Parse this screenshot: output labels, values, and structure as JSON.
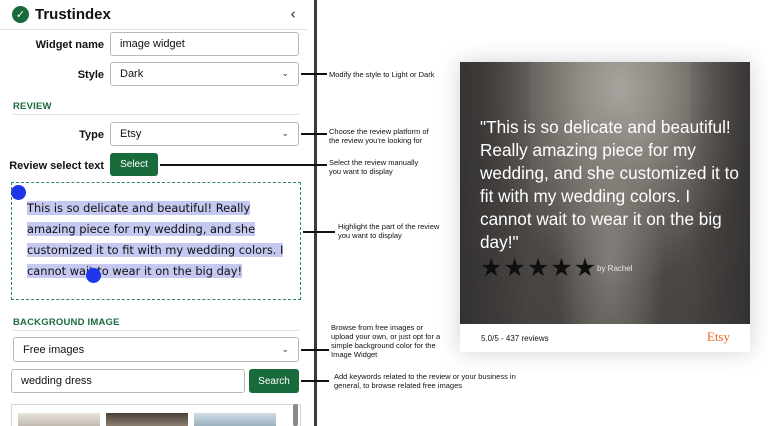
{
  "brand": {
    "name": "Trustindex",
    "logo_glyph": "✓"
  },
  "collapse_glyph": "‹",
  "fields": {
    "widget_name": {
      "label": "Widget name",
      "value": "image widget"
    },
    "style": {
      "label": "Style",
      "value": "Dark"
    },
    "type": {
      "label": "Type",
      "value": "Etsy"
    },
    "review_select": {
      "label": "Review select text",
      "button": "Select"
    }
  },
  "sections": {
    "review": "REVIEW",
    "background": "BACKGROUND IMAGE"
  },
  "selected_text": "This is so delicate and beautiful! Really amazing piece for my wedding, and she customized it to fit with my wedding colors. I cannot wait to wear it on the big day!",
  "background": {
    "source": "Free images",
    "search_value": "wedding dress",
    "search_button": "Search"
  },
  "annotations": {
    "style": "Modify the style to Light or Dark",
    "type_1": "Choose the review  platform of",
    "type_2": "the review you're looking for",
    "select_1": "Select the review manually",
    "select_2": "you want to display",
    "highlight_1": "Highlight the part of the review",
    "highlight_2": "you want to display",
    "browse_1": "Browse from free images or",
    "browse_2": "upload your own, or just opt for a",
    "browse_3": "simple background color for the",
    "browse_4": "Image Widget",
    "keywords_1": "Add keywords related to the review or your business in",
    "keywords_2": "general, to browse related free images"
  },
  "preview": {
    "quote": "\"This is so delicate and beautiful! Really amazing piece for my wedding, and she customized it to fit with my wedding colors. I cannot wait to wear it on the big day!\"",
    "stars": 5,
    "star_glyph": "★",
    "author": "by Rachel",
    "rating_text": "5.0/5 - 437 reviews",
    "platform": "Etsy"
  },
  "colors": {
    "brand_green": "#1a6b3c",
    "selection": "#c5c8f0",
    "handle_blue": "#1e35e8",
    "etsy_orange": "#f1641e"
  },
  "icons": {
    "logo": "check-circle-icon",
    "collapse": "chevron-left-icon",
    "dropdown": "chevron-down-icon",
    "star": "star-icon"
  }
}
